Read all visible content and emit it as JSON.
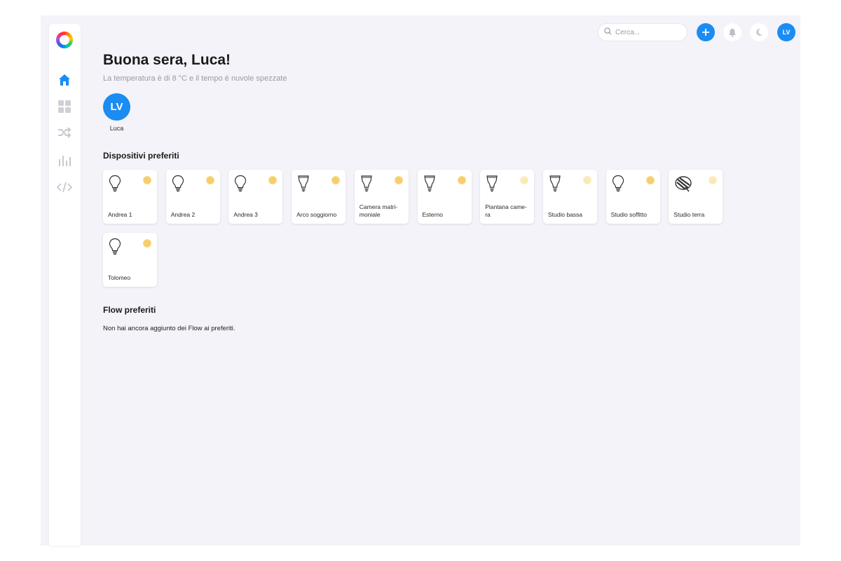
{
  "header": {
    "search_placeholder": "Cerca...",
    "avatar_initials": "LV"
  },
  "greeting": "Buona sera, Luca!",
  "weather_text": "La temperatura è di 8 °C e il tempo è nuvole spezzate",
  "user": {
    "initials": "LV",
    "name": "Luca"
  },
  "sections": {
    "devices_title": "Dispositivi preferiti",
    "flows_title": "Flow preferiti",
    "flows_empty": "Non hai ancora aggiunto dei Flow ai preferiti."
  },
  "devices": [
    {
      "label": "Andrea 1",
      "icon": "bulb-icon",
      "sun_color": "#f7cf6a"
    },
    {
      "label": "Andrea 2",
      "icon": "bulb-icon",
      "sun_color": "#f7cf6a"
    },
    {
      "label": "Andrea 3",
      "icon": "bulb-icon",
      "sun_color": "#f7cf6a"
    },
    {
      "label": "Arco soggiorno",
      "icon": "spot-bulb-icon",
      "sun_color": "#f7cf6a"
    },
    {
      "label": "Camera matri-\nmoniale",
      "icon": "spot-bulb-icon",
      "sun_color": "#f7cf6a"
    },
    {
      "label": "Esterno",
      "icon": "spot-bulb-icon",
      "sun_color": "#f7cf6a"
    },
    {
      "label": "Piantana came-\nra",
      "icon": "spot-bulb-icon",
      "sun_color": "#fbe9b8"
    },
    {
      "label": "Studio bassa",
      "icon": "spot-bulb-icon",
      "sun_color": "#fbe9b8"
    },
    {
      "label": "Studio soffitto",
      "icon": "bulb-icon",
      "sun_color": "#f7cf6a"
    },
    {
      "label": "Studio terra",
      "icon": "lamp-icon",
      "sun_color": "#fbe9b8"
    },
    {
      "label": "Tolomeo",
      "icon": "bulb-icon",
      "sun_color": "#f7cf6a"
    }
  ],
  "colors": {
    "accent": "#1a8cf2",
    "background": "#f3f3f9",
    "nav_active": "#1a8cf2",
    "nav_inactive": "#c8c8d0"
  }
}
